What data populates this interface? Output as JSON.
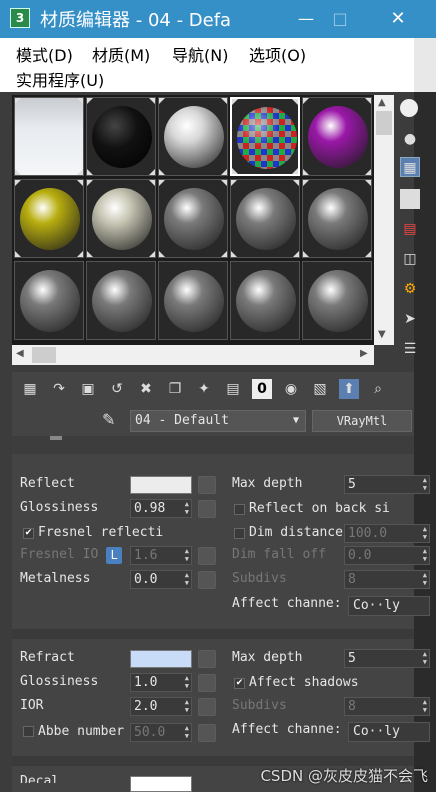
{
  "window": {
    "app_icon_text": "3",
    "title": "材质编辑器 - 04 - Defa"
  },
  "menu": [
    "模式(D)",
    "材质(M)",
    "导航(N)",
    "选项(O)",
    "实用程序(U)"
  ],
  "slots": [
    {
      "kind": "snow",
      "color": "#d8e0e6"
    },
    {
      "kind": "black",
      "color": "#111111"
    },
    {
      "kind": "white",
      "color": "#d8d8d8"
    },
    {
      "kind": "checker",
      "color": "#b33"
    },
    {
      "kind": "purple",
      "color": "#9a18a8"
    },
    {
      "kind": "yellow",
      "color": "#b8ae10"
    },
    {
      "kind": "pearl",
      "color": "#c8c6b4"
    },
    {
      "kind": "gray",
      "color": "#7a7a7a"
    },
    {
      "kind": "gray",
      "color": "#7a7a7a"
    },
    {
      "kind": "gray",
      "color": "#7a7a7a"
    },
    {
      "kind": "gray",
      "color": "#7a7a7a"
    },
    {
      "kind": "gray",
      "color": "#7a7a7a"
    },
    {
      "kind": "gray",
      "color": "#7a7a7a"
    },
    {
      "kind": "gray",
      "color": "#7a7a7a"
    },
    {
      "kind": "gray",
      "color": "#7a7a7a"
    }
  ],
  "toolbar_icons": [
    "get-material-icon",
    "put-to-scene-icon",
    "assign-icon",
    "reset-icon",
    "delete-icon",
    "make-copy-icon",
    "unique-icon",
    "put-to-library-icon",
    "material-id-icon",
    "show-map-icon",
    "show-shaded-icon",
    "go-parent-icon",
    "pick-material-icon"
  ],
  "toolbar_number": "0",
  "material_name": "04 - Default",
  "material_type": "VRayMtl",
  "reflect": {
    "label": "Reflect",
    "color": "#ececec",
    "glossiness_label": "Glossiness",
    "glossiness": "0.98",
    "fresnel_label": "Fresnel reflecti",
    "fresnel_checked": "✔",
    "fresnel_ior_label": "Fresnel IO",
    "fresnel_ior_lock": "L",
    "fresnel_ior": "1.6",
    "metalness_label": "Metalness",
    "metalness": "0.0",
    "max_depth_label": "Max depth",
    "max_depth": "5",
    "reflect_back_label": "Reflect on back si",
    "dim_distance_label": "Dim distance",
    "dim_distance": "100.0",
    "dim_falloff_label": "Dim fall off",
    "dim_falloff": "0.0",
    "subdivs_label": "Subdivs",
    "subdivs": "8",
    "affect_channels_label": "Affect channe:",
    "affect_channels": "Co··ly"
  },
  "refract": {
    "label": "Refract",
    "color": "#c8dcf8",
    "glossiness_label": "Glossiness",
    "glossiness": "1.0",
    "ior_label": "IOR",
    "ior": "2.0",
    "abbe_label": "Abbe number",
    "abbe": "50.0",
    "max_depth_label": "Max depth",
    "max_depth": "5",
    "affect_shadows_label": "Affect shadows",
    "affect_shadows_checked": "✔",
    "subdivs_label": "Subdivs",
    "subdivs": "8",
    "affect_channels_label": "Affect channe:",
    "affect_channels": "Co··ly"
  },
  "next_section_label": "Decal",
  "watermark": "CSDN @灰皮皮猫不会飞"
}
